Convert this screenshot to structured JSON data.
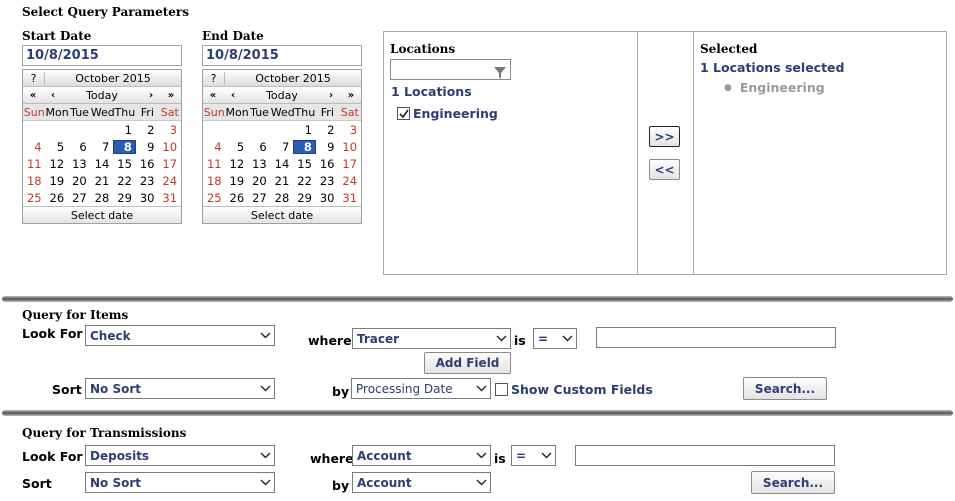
{
  "section_title": "Select Query Parameters",
  "start_date": {
    "label": "Start Date",
    "value": "10/8/2015",
    "calendar": {
      "help": "?",
      "month": "October 2015",
      "nav": {
        "prev_year": "«",
        "prev_month": "‹",
        "today": "Today",
        "next_month": "›",
        "next_year": "»"
      },
      "days": [
        "Sun",
        "Mon",
        "Tue",
        "Wed",
        "Thu",
        "Fri",
        "Sat"
      ],
      "weeks": [
        [
          "",
          "",
          "",
          "",
          "1",
          "2",
          "3"
        ],
        [
          "4",
          "5",
          "6",
          "7",
          "8",
          "9",
          "10"
        ],
        [
          "11",
          "12",
          "13",
          "14",
          "15",
          "16",
          "17"
        ],
        [
          "18",
          "19",
          "20",
          "21",
          "22",
          "23",
          "24"
        ],
        [
          "25",
          "26",
          "27",
          "28",
          "29",
          "30",
          "31"
        ]
      ],
      "selected": "8",
      "footer": "Select date"
    }
  },
  "end_date": {
    "label": "End Date",
    "value": "10/8/2015",
    "calendar": {
      "help": "?",
      "month": "October 2015",
      "nav": {
        "prev_year": "«",
        "prev_month": "‹",
        "today": "Today",
        "next_month": "›",
        "next_year": "»"
      },
      "days": [
        "Sun",
        "Mon",
        "Tue",
        "Wed",
        "Thu",
        "Fri",
        "Sat"
      ],
      "weeks": [
        [
          "",
          "",
          "",
          "",
          "1",
          "2",
          "3"
        ],
        [
          "4",
          "5",
          "6",
          "7",
          "8",
          "9",
          "10"
        ],
        [
          "11",
          "12",
          "13",
          "14",
          "15",
          "16",
          "17"
        ],
        [
          "18",
          "19",
          "20",
          "21",
          "22",
          "23",
          "24"
        ],
        [
          "25",
          "26",
          "27",
          "28",
          "29",
          "30",
          "31"
        ]
      ],
      "selected": "8",
      "footer": "Select date"
    }
  },
  "locations": {
    "title": "Locations",
    "filter_value": "",
    "count_text": "1 Locations",
    "items": [
      {
        "label": "Engineering",
        "checked": true
      }
    ]
  },
  "transfer": {
    "add": ">>",
    "remove": "<<"
  },
  "selected_panel": {
    "title": "Selected",
    "count_text": "1 Locations selected",
    "items": [
      "Engineering"
    ]
  },
  "items_query": {
    "title": "Query for Items",
    "look_for_label": "Look For",
    "look_for_value": "Check",
    "where_label": "where",
    "where_value": "Tracer",
    "is_label": "is",
    "op_value": "=",
    "criteria_value": "",
    "add_field": "Add Field",
    "sort_label": "Sort",
    "sort_value": "No Sort",
    "by_label": "by",
    "by_value": "Processing Date",
    "custom_fields_label": "Show Custom Fields",
    "search": "Search..."
  },
  "trans_query": {
    "title": "Query for Transmissions",
    "look_for_label": "Look For",
    "look_for_value": "Deposits",
    "where_label": "where",
    "where_value": "Account",
    "is_label": "is",
    "op_value": "=",
    "criteria_value": "",
    "sort_label": "Sort",
    "sort_value": "No Sort",
    "by_label": "by",
    "by_value": "Account",
    "search": "Search..."
  },
  "colors": {
    "accent": "#2c3e74",
    "weekend": "#c0392b",
    "selected_day": "#2a5db5"
  }
}
